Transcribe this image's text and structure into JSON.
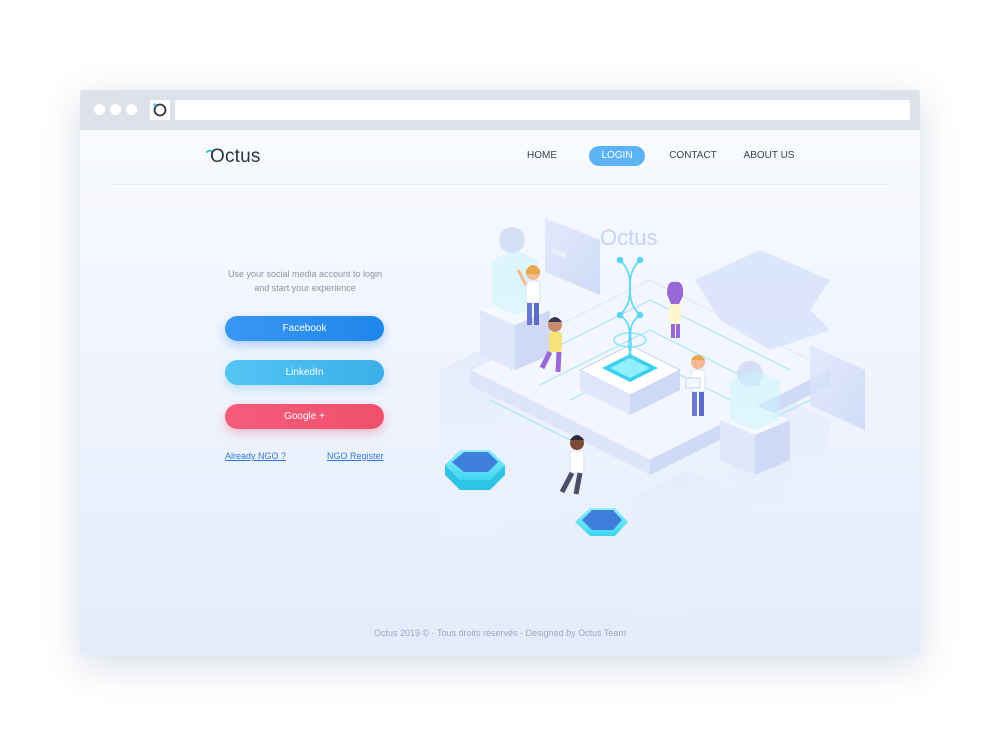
{
  "browser": {
    "window_dots": 3
  },
  "header": {
    "logo_text": "Octus",
    "nav": [
      {
        "label": "HOME",
        "active": false
      },
      {
        "label": "LOGIN",
        "active": true
      },
      {
        "label": "CONTACT",
        "active": false
      },
      {
        "label": "ABOUT US",
        "active": false
      }
    ]
  },
  "login": {
    "intro_line1": "Use your social media account to login",
    "intro_line2": "and start your experience",
    "facebook_label": "Facebook",
    "linkedin_label": "LinkedIn",
    "google_label": "Google +",
    "already_link": "Already NGO ?",
    "register_link": "NGO Register"
  },
  "illustration": {
    "watermark_text": "Octus"
  },
  "footer": {
    "text": "Octus 2019 © - Tous droits réservés - Designed by Octus Team"
  },
  "colors": {
    "accent": "#5cb3f5",
    "facebook": "#2a8df0",
    "linkedin": "#47bbef",
    "google": "#f2566f",
    "text": "#3d4150"
  }
}
